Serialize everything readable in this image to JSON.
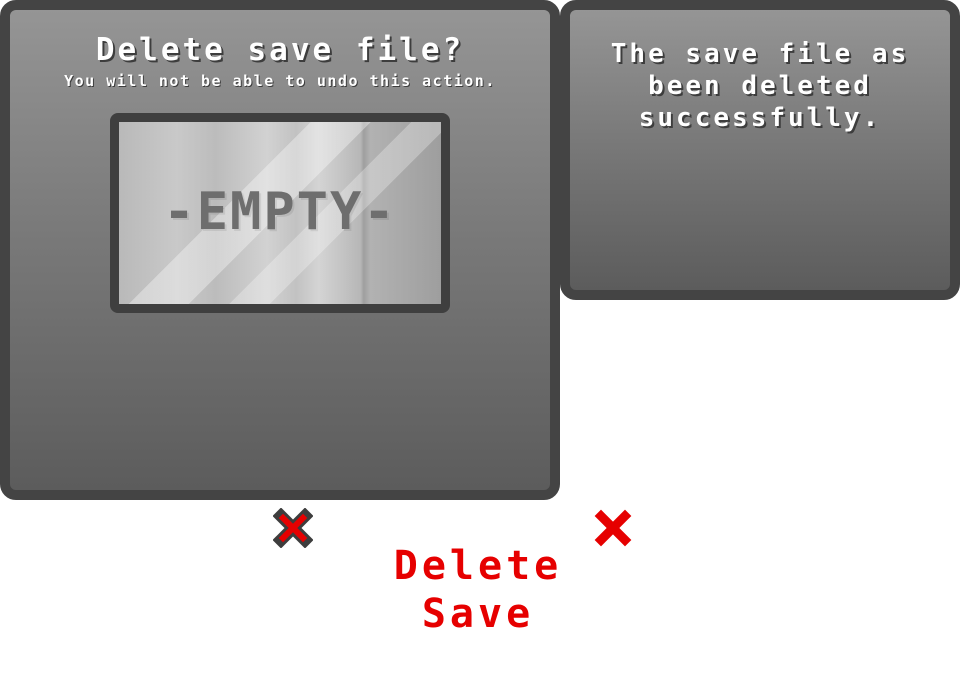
{
  "confirm_dialog": {
    "title": "Delete save file?",
    "subtitle": "You will not be able to undo this action.",
    "slot_label": "-EMPTY-"
  },
  "success_dialog": {
    "line1": "The save file as",
    "line2": "been deleted",
    "line3": "successfully."
  },
  "buttons": {
    "cancel_icon": "x-icon",
    "close_icon": "x-icon",
    "delete_line1": "Delete",
    "delete_line2": "Save"
  },
  "colors": {
    "panel_border": "#444444",
    "accent_red": "#e60000",
    "text": "#ffffff",
    "slot_text": "#6e6e6e"
  }
}
